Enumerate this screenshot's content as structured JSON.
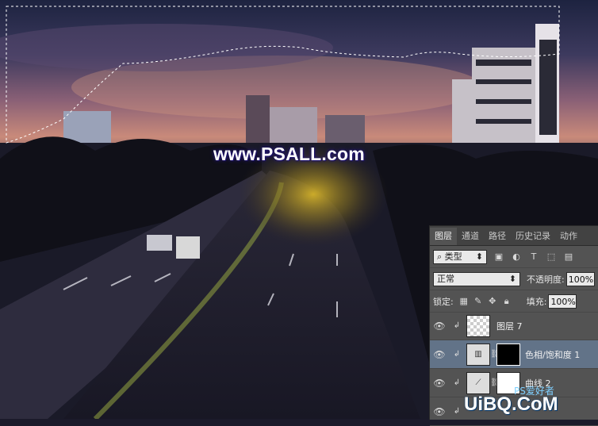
{
  "watermark": "www.PSALL.com",
  "layers_panel": {
    "tabs": [
      "图层",
      "通道",
      "路径",
      "历史记录",
      "动作"
    ],
    "filter": {
      "label": "类型",
      "icons": [
        "image-icon",
        "adjustment-icon",
        "type-icon",
        "shape-icon",
        "smart-object-icon"
      ]
    },
    "blend_mode": "正常",
    "opacity_label": "不透明度:",
    "opacity_value": "100%",
    "lock_label": "锁定:",
    "fill_label": "填充:",
    "fill_value": "100%",
    "layers": [
      {
        "name": "图层 7",
        "selected": false
      },
      {
        "name": "色相/饱和度 1",
        "selected": true
      },
      {
        "name": "曲线 2",
        "selected": false
      }
    ]
  },
  "logo": {
    "text": "UiBQ.CoM",
    "sub": "PS爱好者"
  }
}
